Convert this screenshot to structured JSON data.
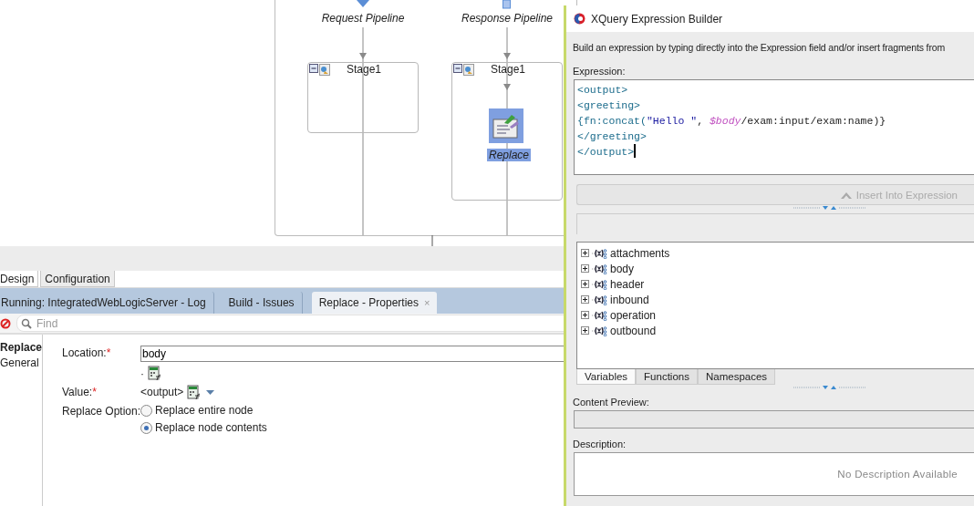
{
  "diagram": {
    "pipelines": [
      {
        "label": "Request Pipeline",
        "stage": {
          "title": "Stage1"
        }
      },
      {
        "label": "Response Pipeline",
        "stage": {
          "title": "Stage1",
          "actions": [
            {
              "label": "Replace",
              "selected": true
            }
          ]
        }
      }
    ]
  },
  "editor_tabs": [
    {
      "label": "Design",
      "selected": true
    },
    {
      "label": "Configuration",
      "selected": false
    }
  ],
  "panel_tabs": [
    {
      "label": "Running: IntegratedWebLogicServer - Log",
      "selected": false
    },
    {
      "label": "Build - Issues",
      "selected": false
    },
    {
      "label": "Replace - Properties",
      "selected": true,
      "close": "×"
    }
  ],
  "find": {
    "placeholder": "Find"
  },
  "properties": {
    "nav": [
      {
        "label": "Replace",
        "selected": true
      },
      {
        "label": "General",
        "selected": false
      }
    ],
    "location": {
      "label": "Location:",
      "required": "*",
      "value": "body",
      "hint": "·"
    },
    "value": {
      "label": "Value:",
      "required": "*",
      "value": "<output>"
    },
    "replace_option": {
      "label": "Replace Option:",
      "options": [
        {
          "label": "Replace entire node",
          "selected": false
        },
        {
          "label": "Replace node contents",
          "selected": true
        }
      ]
    }
  },
  "dialog": {
    "title": "XQuery Expression Builder",
    "instruction": "Build an expression by typing directly into the Expression field and/or insert fragments from",
    "expression_label": "Expression:",
    "expression": [
      [
        {
          "kind": "tag",
          "text": "<output>"
        }
      ],
      [
        {
          "kind": "tag",
          "text": "<greeting>"
        }
      ],
      [
        {
          "kind": "tag",
          "text": "{fn:concat("
        },
        {
          "kind": "string",
          "text": "\"Hello \""
        },
        {
          "kind": "plain",
          "text": ", "
        },
        {
          "kind": "variable",
          "text": "$body"
        },
        {
          "kind": "plain",
          "text": "/exam:input/exam:name)}"
        }
      ],
      [
        {
          "kind": "tag",
          "text": "</greeting>"
        }
      ],
      [
        {
          "kind": "tag",
          "text": "</output>"
        }
      ]
    ],
    "insert_button": {
      "label": "Insert Into Expression",
      "disabled": true
    },
    "tree": [
      {
        "label": "attachments",
        "expanded": false
      },
      {
        "label": "body",
        "expanded": false
      },
      {
        "label": "header",
        "expanded": false
      },
      {
        "label": "inbound",
        "expanded": false
      },
      {
        "label": "operation",
        "expanded": false
      },
      {
        "label": "outbound",
        "expanded": false
      }
    ],
    "tabs": [
      {
        "label": "Variables",
        "selected": true
      },
      {
        "label": "Functions",
        "selected": false
      },
      {
        "label": "Namespaces",
        "selected": false
      }
    ],
    "content_preview_label": "Content Preview:",
    "description_label": "Description:",
    "description": "No Description Available"
  }
}
